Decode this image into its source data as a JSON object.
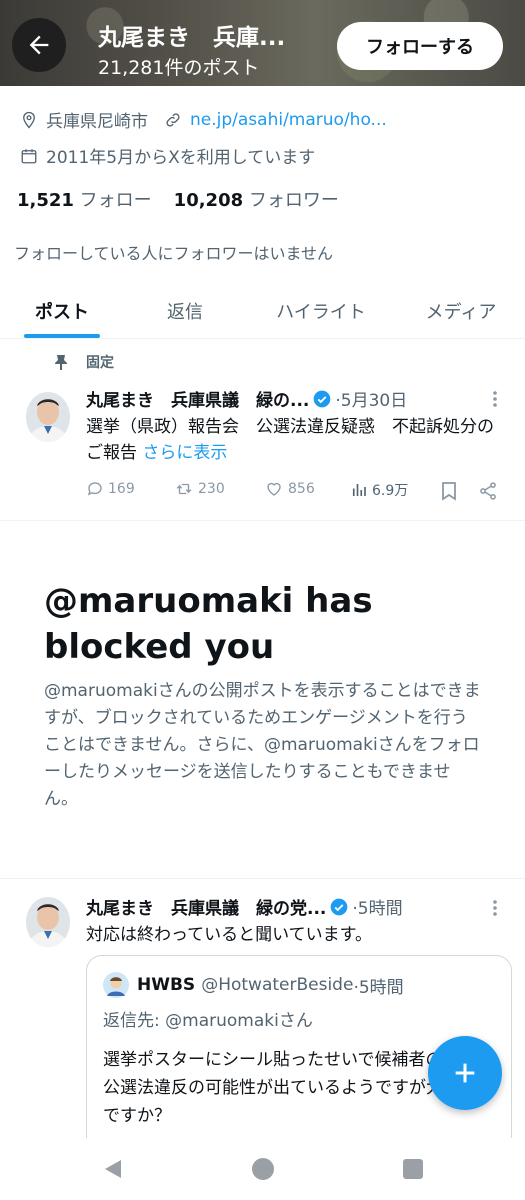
{
  "header": {
    "name": "丸尾まき　兵庫...",
    "post_count": "21,281件のポスト",
    "follow_label": "フォローする"
  },
  "profile": {
    "location": "兵庫県尼崎市",
    "link": "ne.jp/asahi/maruo/ho...",
    "joined": "2011年5月からXを利用しています",
    "following_count": "1,521",
    "following_label": "フォロー",
    "followers_count": "10,208",
    "followers_label": "フォロワー",
    "mutual_note": "フォローしている人にフォロワーはいません"
  },
  "tabs": [
    {
      "label": "ポスト"
    },
    {
      "label": "返信"
    },
    {
      "label": "ハイライト"
    },
    {
      "label": "メディア"
    }
  ],
  "pinned_tweet": {
    "pinned_label": "固定",
    "name": "丸尾まき　兵庫県議　緑の...",
    "date": "·5月30日",
    "text": "選挙（県政）報告会　公選法違反疑惑　不起訴処分のご報告",
    "show_more": "さらに表示",
    "replies": "169",
    "retweets": "230",
    "likes": "856",
    "views": "6.9万"
  },
  "blocked": {
    "title": "@maruomaki has blocked you",
    "body": "@maruomakiさんの公開ポストを表示することはできますが、ブロックされているためエンゲージメントを行うことはできません。さらに、@maruomakiさんをフォローしたりメッセージを送信したりすることもできません。"
  },
  "tweet2": {
    "name": "丸尾まき　兵庫県議　緑の党...",
    "time": "·5時間",
    "text": "対応は終わっていると聞いています。",
    "quote": {
      "name": "HWBS",
      "handle": "@HotwaterBeside",
      "time": "·5時間",
      "reply_to_prefix": "返信先: ",
      "reply_to_user": "@maruomakiさん",
      "text": "選挙ポスターにシール貼ったせいで候補者の方、公選法違反の可能性が出ているようですが大丈夫ですか？"
    }
  },
  "colors": {
    "accent": "#1d9bf0",
    "text_primary": "#0f1419",
    "text_secondary": "#536471"
  }
}
